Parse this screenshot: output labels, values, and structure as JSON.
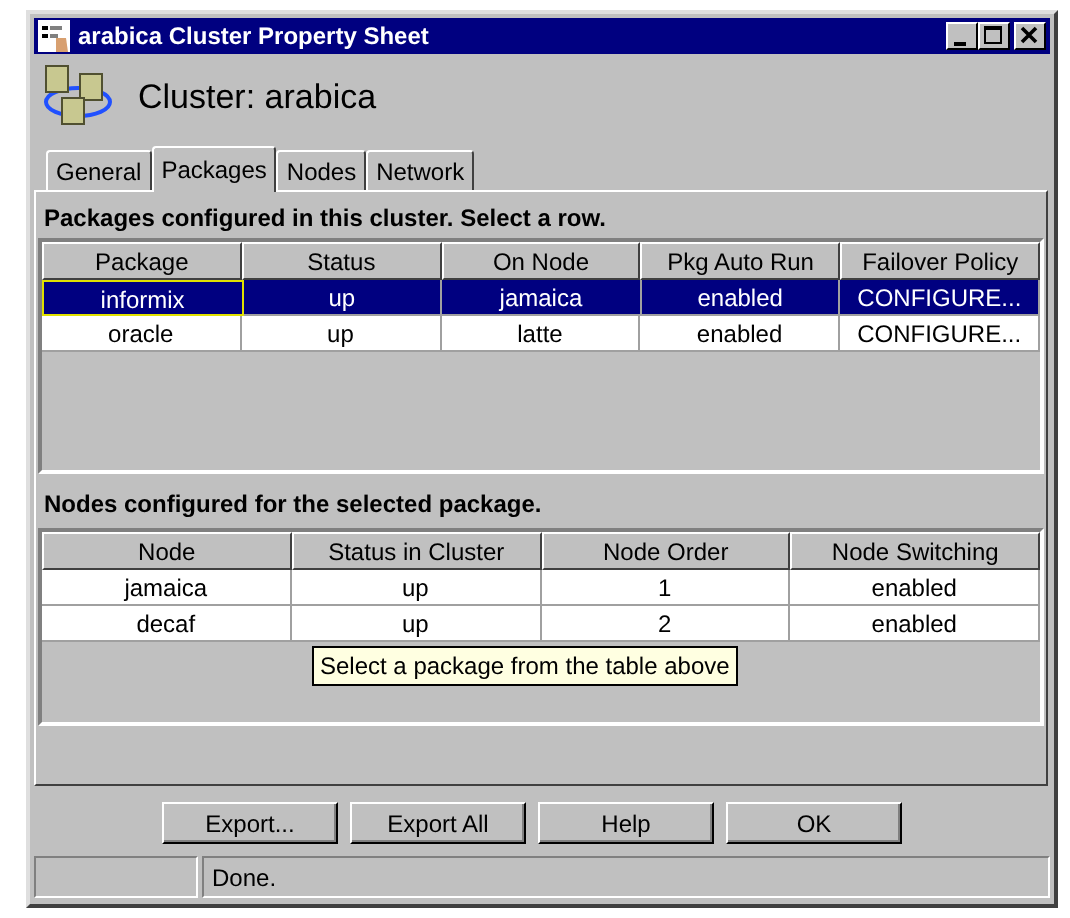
{
  "window": {
    "title": "arabica Cluster Property Sheet"
  },
  "header": {
    "title": "Cluster: arabica"
  },
  "tabs": [
    {
      "label": "General",
      "selected": false
    },
    {
      "label": "Packages",
      "selected": true
    },
    {
      "label": "Nodes",
      "selected": false
    },
    {
      "label": "Network",
      "selected": false
    }
  ],
  "packages": {
    "caption": "Packages configured in this cluster. Select a row.",
    "columns": [
      "Package",
      "Status",
      "On Node",
      "Pkg Auto Run",
      "Failover Policy"
    ],
    "rows": [
      {
        "cells": [
          "informix",
          "up",
          "jamaica",
          "enabled",
          "CONFIGURE..."
        ],
        "selected": true,
        "focused": true
      },
      {
        "cells": [
          "oracle",
          "up",
          "latte",
          "enabled",
          "CONFIGURE..."
        ],
        "selected": false,
        "focused": false
      }
    ]
  },
  "nodes": {
    "caption": "Nodes configured for the selected package.",
    "columns": [
      "Node",
      "Status in Cluster",
      "Node Order",
      "Node Switching"
    ],
    "rows": [
      {
        "cells": [
          "jamaica",
          "up",
          "1",
          "enabled"
        ]
      },
      {
        "cells": [
          "decaf",
          "up",
          "2",
          "enabled"
        ]
      }
    ]
  },
  "tooltip": {
    "text": "Select a package from the table above"
  },
  "buttons": [
    "Export...",
    "Export All",
    "Help",
    "OK"
  ],
  "status_bar": {
    "message": "Done."
  }
}
